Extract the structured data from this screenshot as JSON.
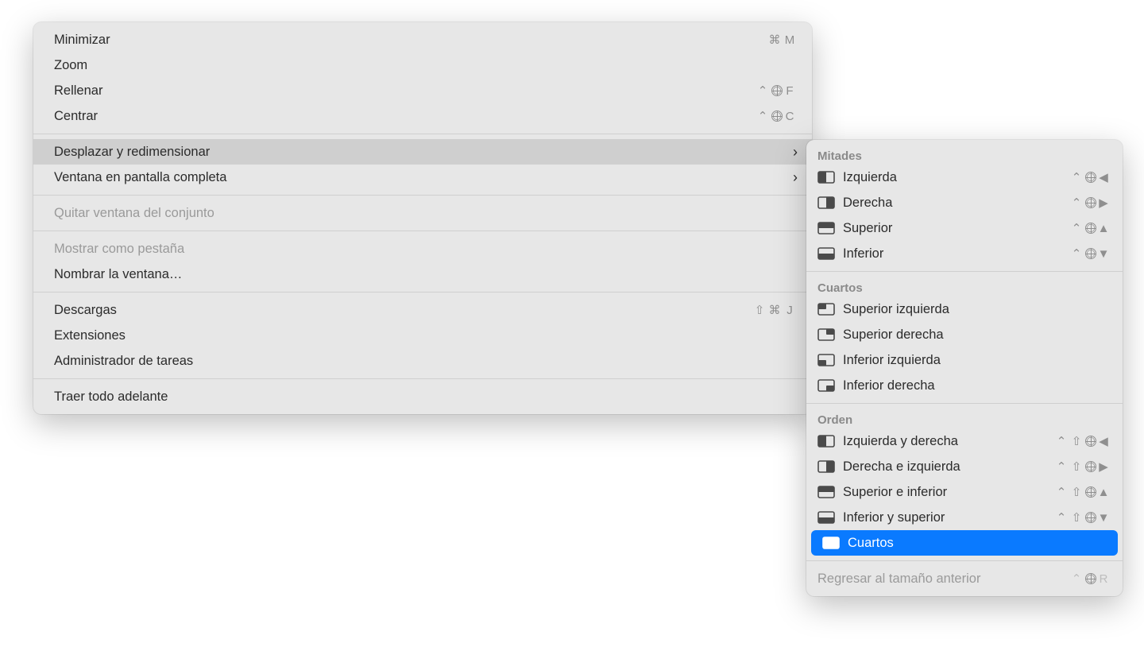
{
  "mainMenu": {
    "groups": [
      [
        {
          "id": "minimize",
          "label": "Minimizar",
          "shortcut": [
            "cmd",
            "M"
          ]
        },
        {
          "id": "zoom",
          "label": "Zoom"
        },
        {
          "id": "fill",
          "label": "Rellenar",
          "shortcut": [
            "ctrl",
            "globe",
            "F"
          ]
        },
        {
          "id": "center",
          "label": "Centrar",
          "shortcut": [
            "ctrl",
            "globe",
            "C"
          ]
        }
      ],
      [
        {
          "id": "move-resize",
          "label": "Desplazar y redimensionar",
          "submenu": true,
          "hover": true
        },
        {
          "id": "fullscreen",
          "label": "Ventana en pantalla completa",
          "submenu": true
        }
      ],
      [
        {
          "id": "remove-from-set",
          "label": "Quitar ventana del conjunto",
          "disabled": true
        }
      ],
      [
        {
          "id": "show-as-tab",
          "label": "Mostrar como pestaña",
          "disabled": true
        },
        {
          "id": "name-window",
          "label": "Nombrar la ventana…"
        }
      ],
      [
        {
          "id": "downloads",
          "label": "Descargas",
          "shortcut": [
            "shift",
            "cmd",
            "J"
          ]
        },
        {
          "id": "extensions",
          "label": "Extensiones"
        },
        {
          "id": "task-manager",
          "label": "Administrador de tareas"
        }
      ],
      [
        {
          "id": "bring-all-front",
          "label": "Traer todo adelante"
        }
      ]
    ]
  },
  "subMenu": {
    "sections": [
      {
        "title": "Mitades",
        "items": [
          {
            "id": "half-left",
            "label": "Izquierda",
            "icon": "rect-left",
            "shortcut": [
              "ctrl",
              "globe",
              "left"
            ]
          },
          {
            "id": "half-right",
            "label": "Derecha",
            "icon": "rect-right",
            "shortcut": [
              "ctrl",
              "globe",
              "right"
            ]
          },
          {
            "id": "half-top",
            "label": "Superior",
            "icon": "rect-top",
            "shortcut": [
              "ctrl",
              "globe",
              "up"
            ]
          },
          {
            "id": "half-bottom",
            "label": "Inferior",
            "icon": "rect-bottom",
            "shortcut": [
              "ctrl",
              "globe",
              "down"
            ]
          }
        ]
      },
      {
        "title": "Cuartos",
        "items": [
          {
            "id": "q-tl",
            "label": "Superior izquierda",
            "icon": "rect-tl"
          },
          {
            "id": "q-tr",
            "label": "Superior derecha",
            "icon": "rect-tr"
          },
          {
            "id": "q-bl",
            "label": "Inferior izquierda",
            "icon": "rect-bl"
          },
          {
            "id": "q-br",
            "label": "Inferior derecha",
            "icon": "rect-br"
          }
        ]
      },
      {
        "title": "Orden",
        "items": [
          {
            "id": "arr-lr",
            "label": "Izquierda y derecha",
            "icon": "rect-left",
            "shortcut": [
              "ctrl",
              "shift",
              "globe",
              "left"
            ]
          },
          {
            "id": "arr-rl",
            "label": "Derecha e izquierda",
            "icon": "rect-right",
            "shortcut": [
              "ctrl",
              "shift",
              "globe",
              "right"
            ]
          },
          {
            "id": "arr-tb",
            "label": "Superior e inferior",
            "icon": "rect-top",
            "shortcut": [
              "ctrl",
              "shift",
              "globe",
              "up"
            ]
          },
          {
            "id": "arr-bt",
            "label": "Inferior y superior",
            "icon": "rect-bottom",
            "shortcut": [
              "ctrl",
              "shift",
              "globe",
              "down"
            ]
          },
          {
            "id": "arr-quarters",
            "label": "Cuartos",
            "icon": "rect-grid",
            "selected": true
          }
        ]
      }
    ],
    "footer": {
      "id": "restore",
      "label": "Regresar al tamaño anterior",
      "disabled": true,
      "shortcut": [
        "ctrl",
        "globe",
        "R"
      ]
    }
  },
  "glyphs": {
    "cmd": "⌘",
    "shift": "⇧",
    "ctrl": "⌃",
    "opt": "⌥",
    "left": "◀",
    "right": "▶",
    "up": "▲",
    "down": "▼"
  }
}
